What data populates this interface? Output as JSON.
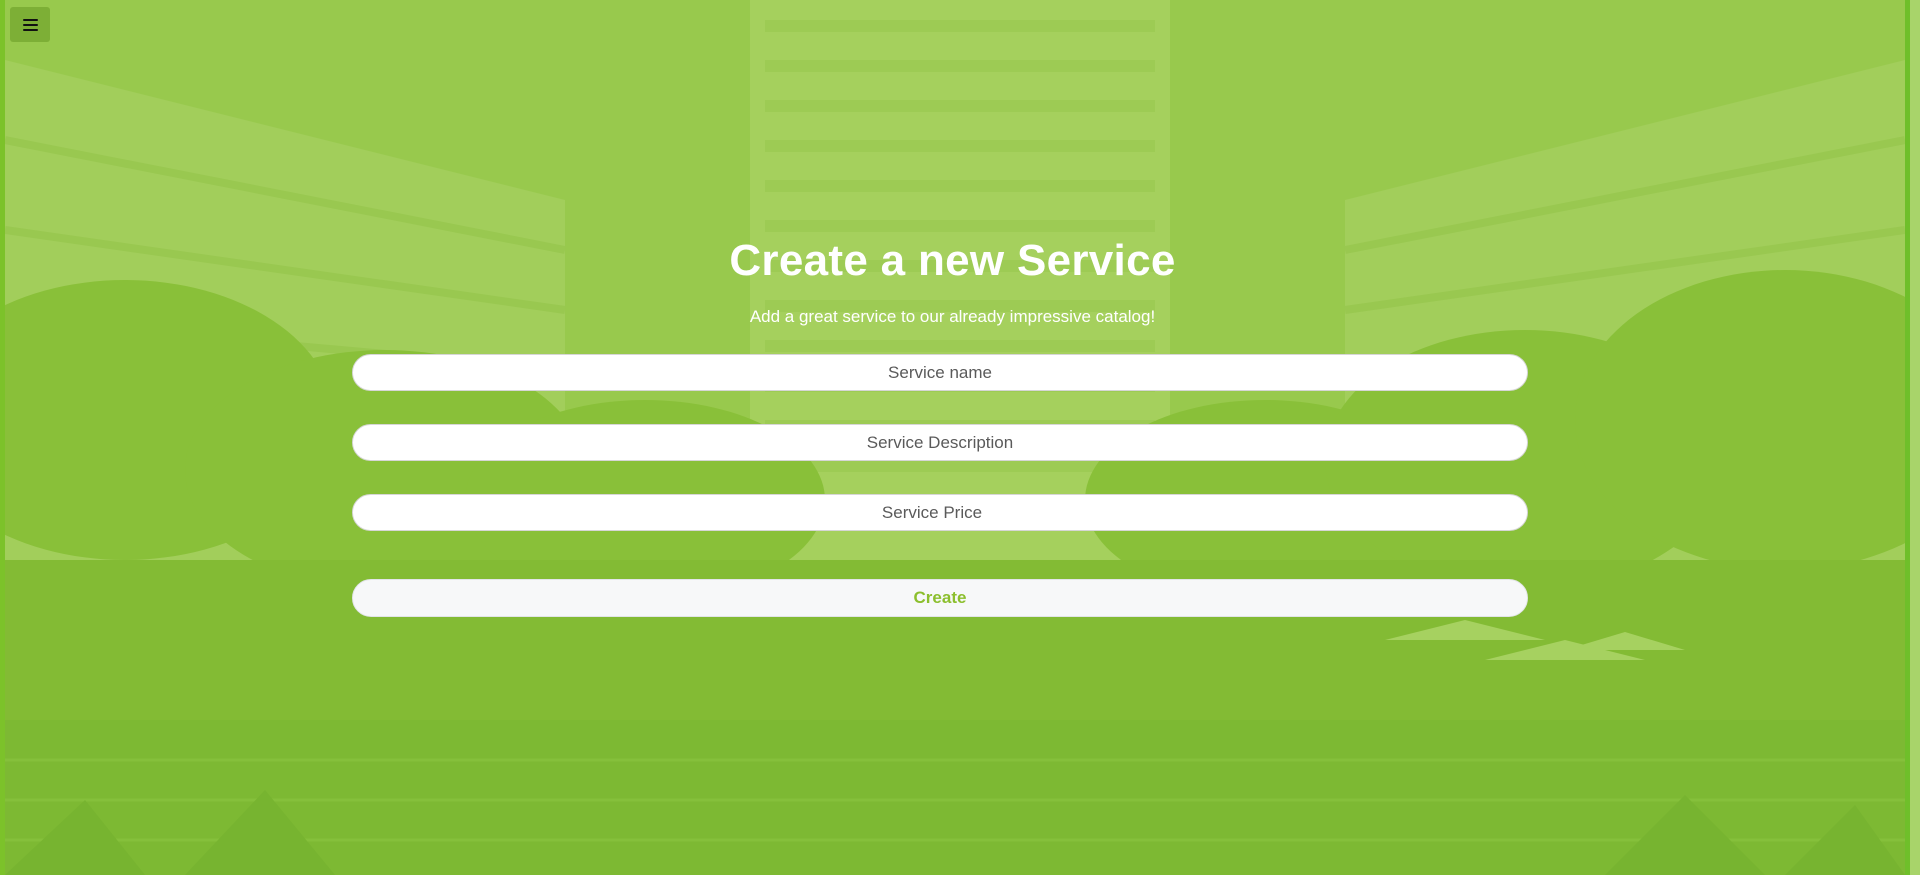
{
  "menu": {
    "icon": "hamburger-menu-icon"
  },
  "heading": {
    "title": "Create a new Service",
    "subtitle": "Add a great service to our already impressive catalog!"
  },
  "form": {
    "name_placeholder": "Service name",
    "description_placeholder": "Service Description",
    "price_placeholder": "Service Price",
    "submit_label": "Create"
  },
  "colors": {
    "overlay": "#8cc43c",
    "button_text": "#8cbf2e",
    "heading_text": "#ffffff"
  },
  "background": {
    "icon": "resort-hotel-background-image"
  }
}
